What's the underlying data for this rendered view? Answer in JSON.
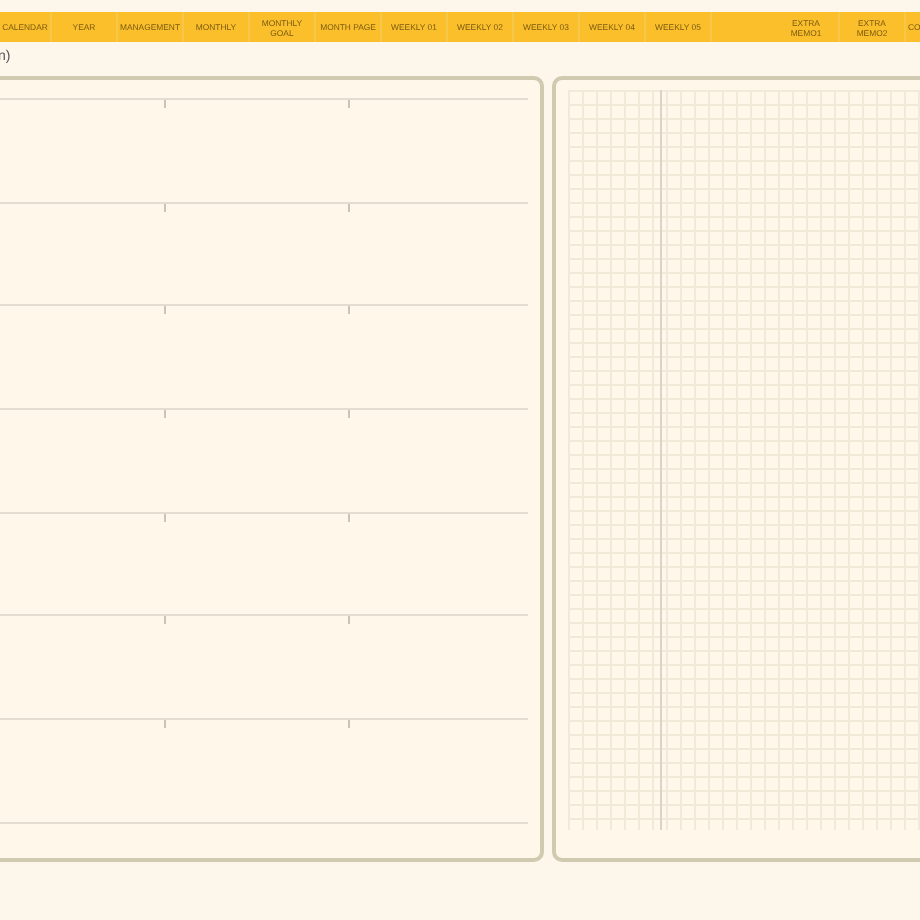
{
  "tabs": [
    "CALENDAR",
    "YEAR",
    "MANAGEMENT",
    "MONTHLY",
    "MONTHLY GOAL",
    "MONTH PAGE",
    "WEEKLY 01",
    "WEEKLY 02",
    "WEEKLY 03",
    "WEEKLY 04",
    "WEEKLY 05"
  ],
  "extra_tabs": [
    "EXTRA MEMO1",
    "EXTRA MEMO2",
    "CO"
  ],
  "heading": "n)"
}
